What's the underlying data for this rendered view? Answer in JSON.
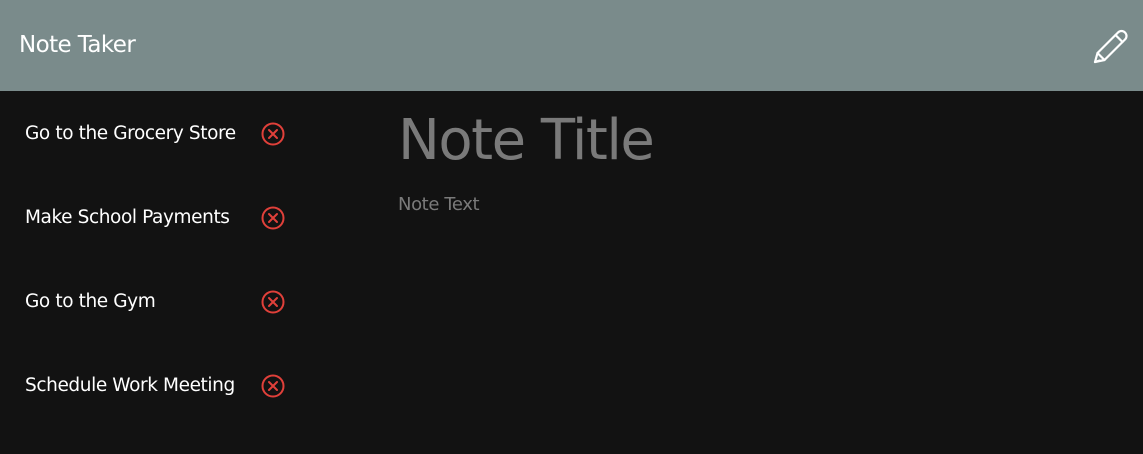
{
  "navbar": {
    "brand": "Note Taker",
    "new_note_icon": "pencil-icon"
  },
  "notes": [
    {
      "title": "Go to the Grocery Store",
      "delete_icon": "circle-x-icon"
    },
    {
      "title": "Make School Payments",
      "delete_icon": "circle-x-icon"
    },
    {
      "title": "Go to the Gym",
      "delete_icon": "circle-x-icon"
    },
    {
      "title": "Schedule Work Meeting",
      "delete_icon": "circle-x-icon"
    }
  ],
  "editor": {
    "title_value": "",
    "title_placeholder": "Note Title",
    "text_value": "",
    "text_placeholder": "Note Text"
  },
  "colors": {
    "navbar_bg": "#7a8b8b",
    "page_bg": "#121212",
    "delete_red": "#e0403a",
    "placeholder_gray": "#7a7a7a"
  }
}
